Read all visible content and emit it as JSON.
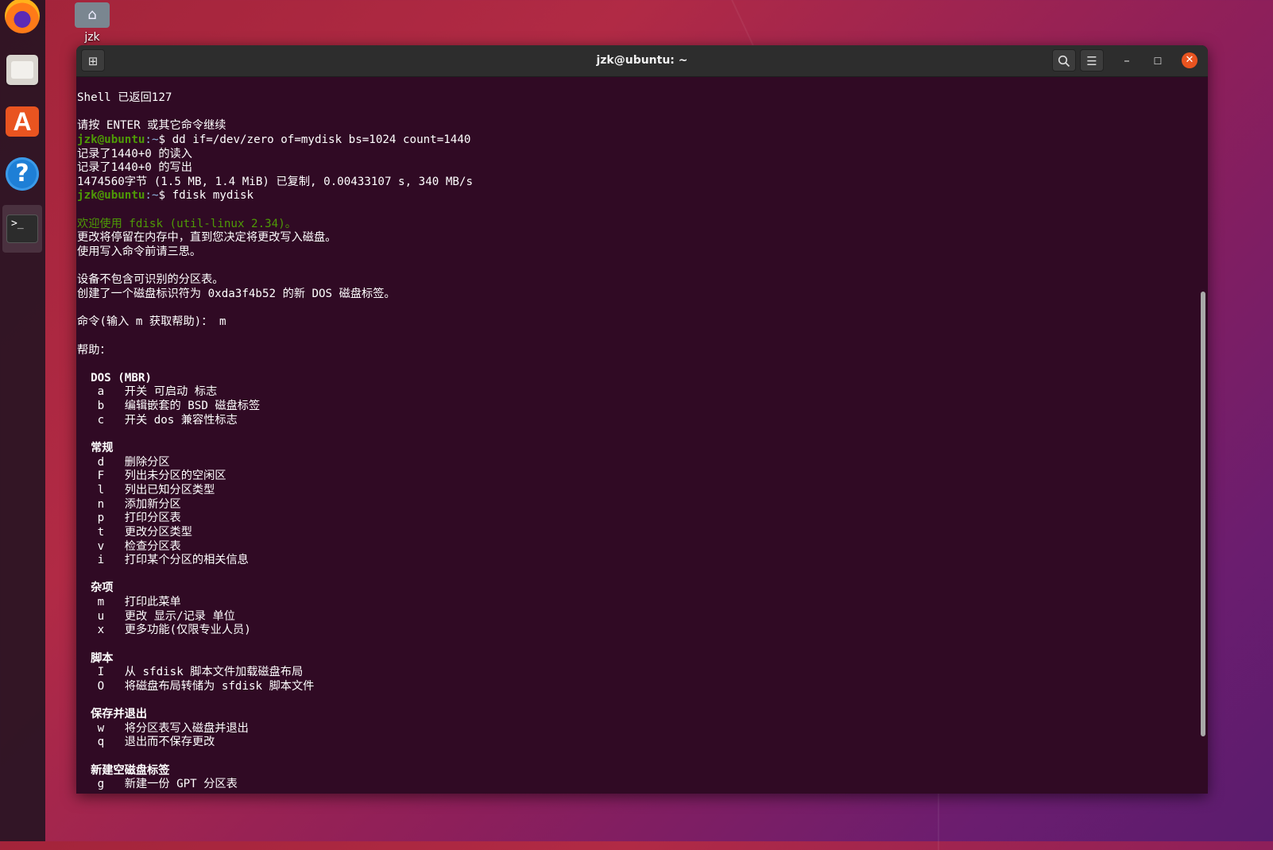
{
  "desktop": {
    "home_label": "jzk"
  },
  "window": {
    "title": "jzk@ubuntu: ~"
  },
  "terminal": {
    "prompt_user": "jzk@ubuntu",
    "prompt_path": ":~",
    "lines": [
      {
        "kind": "text",
        "text": "Shell 已返回127"
      },
      {
        "kind": "blank",
        "text": ""
      },
      {
        "kind": "text",
        "text": "请按 ENTER 或其它命令继续"
      },
      {
        "kind": "prompt",
        "text": "$ dd if=/dev/zero of=mydisk bs=1024 count=1440"
      },
      {
        "kind": "text",
        "text": "记录了1440+0 的读入"
      },
      {
        "kind": "text",
        "text": "记录了1440+0 的写出"
      },
      {
        "kind": "text",
        "text": "1474560字节 (1.5 MB, 1.4 MiB) 已复制, 0.00433107 s, 340 MB/s"
      },
      {
        "kind": "prompt",
        "text": "$ fdisk mydisk"
      },
      {
        "kind": "blank",
        "text": ""
      },
      {
        "kind": "welcome",
        "text": "欢迎使用 fdisk (util-linux 2.34)。"
      },
      {
        "kind": "text",
        "text": "更改将停留在内存中，直到您决定将更改写入磁盘。"
      },
      {
        "kind": "text",
        "text": "使用写入命令前请三思。"
      },
      {
        "kind": "blank",
        "text": ""
      },
      {
        "kind": "text",
        "text": "设备不包含可识别的分区表。"
      },
      {
        "kind": "text",
        "text": "创建了一个磁盘标识符为 0xda3f4b52 的新 DOS 磁盘标签。"
      },
      {
        "kind": "blank",
        "text": ""
      },
      {
        "kind": "text",
        "text": "命令(输入 m 获取帮助)： m"
      },
      {
        "kind": "blank",
        "text": ""
      },
      {
        "kind": "text",
        "text": "帮助："
      },
      {
        "kind": "blank",
        "text": ""
      },
      {
        "kind": "section",
        "text": "  DOS (MBR)"
      },
      {
        "kind": "text",
        "text": "   a   开关 可启动 标志"
      },
      {
        "kind": "text",
        "text": "   b   编辑嵌套的 BSD 磁盘标签"
      },
      {
        "kind": "text",
        "text": "   c   开关 dos 兼容性标志"
      },
      {
        "kind": "blank",
        "text": ""
      },
      {
        "kind": "section",
        "text": "  常规"
      },
      {
        "kind": "text",
        "text": "   d   删除分区"
      },
      {
        "kind": "text",
        "text": "   F   列出未分区的空闲区"
      },
      {
        "kind": "text",
        "text": "   l   列出已知分区类型"
      },
      {
        "kind": "text",
        "text": "   n   添加新分区"
      },
      {
        "kind": "text",
        "text": "   p   打印分区表"
      },
      {
        "kind": "text",
        "text": "   t   更改分区类型"
      },
      {
        "kind": "text",
        "text": "   v   检查分区表"
      },
      {
        "kind": "text",
        "text": "   i   打印某个分区的相关信息"
      },
      {
        "kind": "blank",
        "text": ""
      },
      {
        "kind": "section",
        "text": "  杂项"
      },
      {
        "kind": "text",
        "text": "   m   打印此菜单"
      },
      {
        "kind": "text",
        "text": "   u   更改 显示/记录 单位"
      },
      {
        "kind": "text",
        "text": "   x   更多功能(仅限专业人员)"
      },
      {
        "kind": "blank",
        "text": ""
      },
      {
        "kind": "section",
        "text": "  脚本"
      },
      {
        "kind": "text",
        "text": "   I   从 sfdisk 脚本文件加载磁盘布局"
      },
      {
        "kind": "text",
        "text": "   O   将磁盘布局转储为 sfdisk 脚本文件"
      },
      {
        "kind": "blank",
        "text": ""
      },
      {
        "kind": "section",
        "text": "  保存并退出"
      },
      {
        "kind": "text",
        "text": "   w   将分区表写入磁盘并退出"
      },
      {
        "kind": "text",
        "text": "   q   退出而不保存更改"
      },
      {
        "kind": "blank",
        "text": ""
      },
      {
        "kind": "section",
        "text": "  新建空磁盘标签"
      },
      {
        "kind": "text",
        "text": "   g   新建一份 GPT 分区表"
      }
    ]
  }
}
